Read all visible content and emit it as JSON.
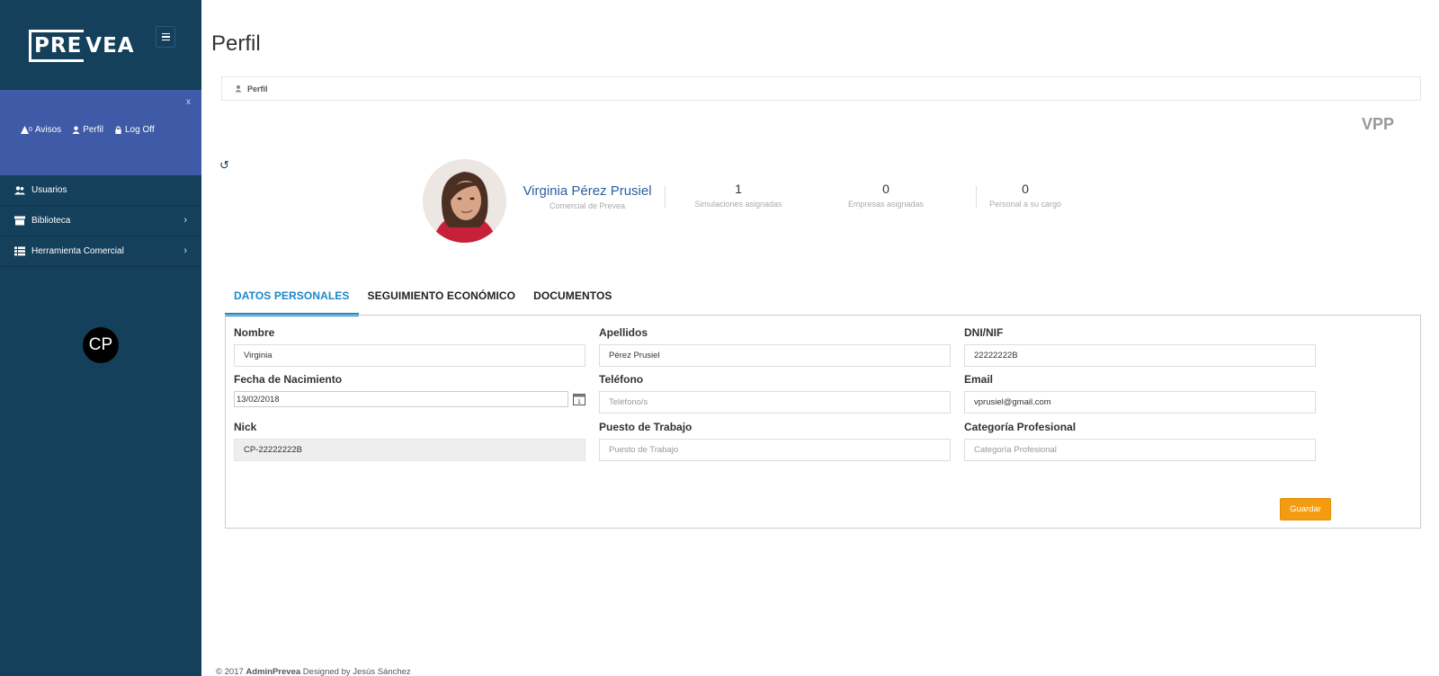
{
  "sidebar": {
    "logo_boxed": "PRE",
    "logo_rest": "VEA",
    "close_label": "x",
    "user_links": {
      "avisos_count": "0",
      "avisos": "Avisos",
      "perfil": "Perfil",
      "logoff": "Log Off"
    },
    "items": [
      {
        "label": "Usuarios",
        "icon": "users-icon"
      },
      {
        "label": "Biblioteca",
        "icon": "archive-icon"
      },
      {
        "label": "Herramienta Comercial",
        "icon": "list-icon"
      }
    ],
    "chevron": "›",
    "badge": "CP"
  },
  "header": {
    "title": "Perfil",
    "breadcrumb": "Perfil",
    "initials": "VPP",
    "refresh_glyph": "↺"
  },
  "profile": {
    "name": "Virginia Pérez Prusiel",
    "role": "Comercial de Prevea",
    "stats": [
      {
        "value": "1",
        "label": "Simulaciones asignadas"
      },
      {
        "value": "0",
        "label": "Empresas asignadas"
      },
      {
        "value": "0",
        "label": "Personal a su cargo"
      }
    ]
  },
  "tabs": [
    {
      "label": "DATOS PERSONALES",
      "active": true
    },
    {
      "label": "SEGUIMIENTO ECONÓMICO",
      "active": false
    },
    {
      "label": "DOCUMENTOS",
      "active": false
    }
  ],
  "form": {
    "nombre": {
      "label": "Nombre",
      "value": "Virginia"
    },
    "apellidos": {
      "label": "Apellidos",
      "value": "Pérez Prusiel"
    },
    "dni": {
      "label": "DNI/NIF",
      "value": "22222222B"
    },
    "fecha": {
      "label": "Fecha de Nacimiento",
      "value": "13/02/2018"
    },
    "telefono": {
      "label": "Teléfono",
      "value": "",
      "placeholder": "Teléfono/s"
    },
    "email": {
      "label": "Email",
      "value": "vprusiel@gmail.com"
    },
    "nick": {
      "label": "Nick",
      "value": "CP-22222222B"
    },
    "puesto": {
      "label": "Puesto de Trabajo",
      "value": "",
      "placeholder": "Puesto de Trabajo"
    },
    "categoria": {
      "label": "Categoría Profesional",
      "value": "",
      "placeholder": "Categoría Profesional"
    },
    "save_label": "Guardar"
  },
  "footer": {
    "prefix": "© 2017",
    "brand": "AdminPrevea",
    "suffix": "Designed by Jesús Sánchez"
  },
  "colors": {
    "sidebar_bg": "#15405b",
    "user_panel_bg": "#3f5ba7",
    "accent": "#1c87c9",
    "save_button": "#f39c12"
  }
}
